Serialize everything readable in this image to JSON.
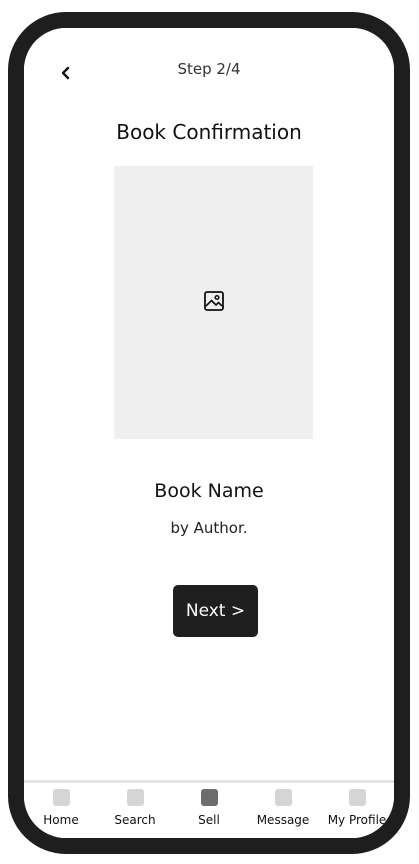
{
  "header": {
    "step": "Step 2/4",
    "title": "Book Confirmation"
  },
  "book": {
    "name": "Book Name",
    "author": "by Author."
  },
  "actions": {
    "next_label": "Next >"
  },
  "tabs": [
    {
      "label": "Home",
      "icon": "home-icon",
      "active": false
    },
    {
      "label": "Search",
      "icon": "search-icon",
      "active": false
    },
    {
      "label": "Sell",
      "icon": "sell-icon",
      "active": true
    },
    {
      "label": "Message",
      "icon": "message-icon",
      "active": false
    },
    {
      "label": "My Profile",
      "icon": "profile-icon",
      "active": false
    }
  ],
  "colors": {
    "frame": "#1e1e1e",
    "button": "#1f1f1f",
    "placeholder": "#efefef",
    "tab_inactive": "#d5d5d5",
    "tab_active": "#6d6d6d"
  }
}
